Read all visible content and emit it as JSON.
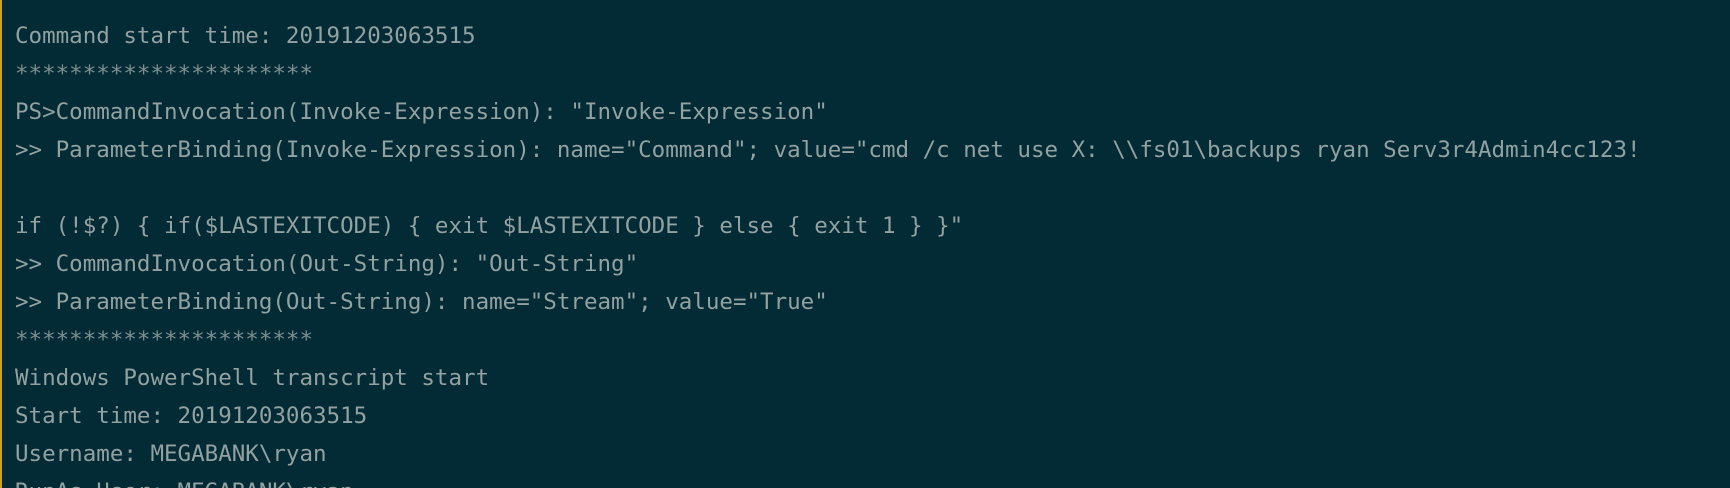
{
  "terminal": {
    "lines": [
      "**********************",
      "Command start time: 20191203063515",
      "**********************",
      "PS>CommandInvocation(Invoke-Expression): \"Invoke-Expression\"",
      ">> ParameterBinding(Invoke-Expression): name=\"Command\"; value=\"cmd /c net use X: \\\\fs01\\backups ryan Serv3r4Admin4cc123!",
      "",
      "if (!$?) { if($LASTEXITCODE) { exit $LASTEXITCODE } else { exit 1 } }\"",
      ">> CommandInvocation(Out-String): \"Out-String\"",
      ">> ParameterBinding(Out-String): name=\"Stream\"; value=\"True\"",
      "**********************",
      "Windows PowerShell transcript start",
      "Start time: 20191203063515",
      "Username: MEGABANK\\ryan",
      "RunAs User: MEGABANK\\ryan"
    ]
  }
}
